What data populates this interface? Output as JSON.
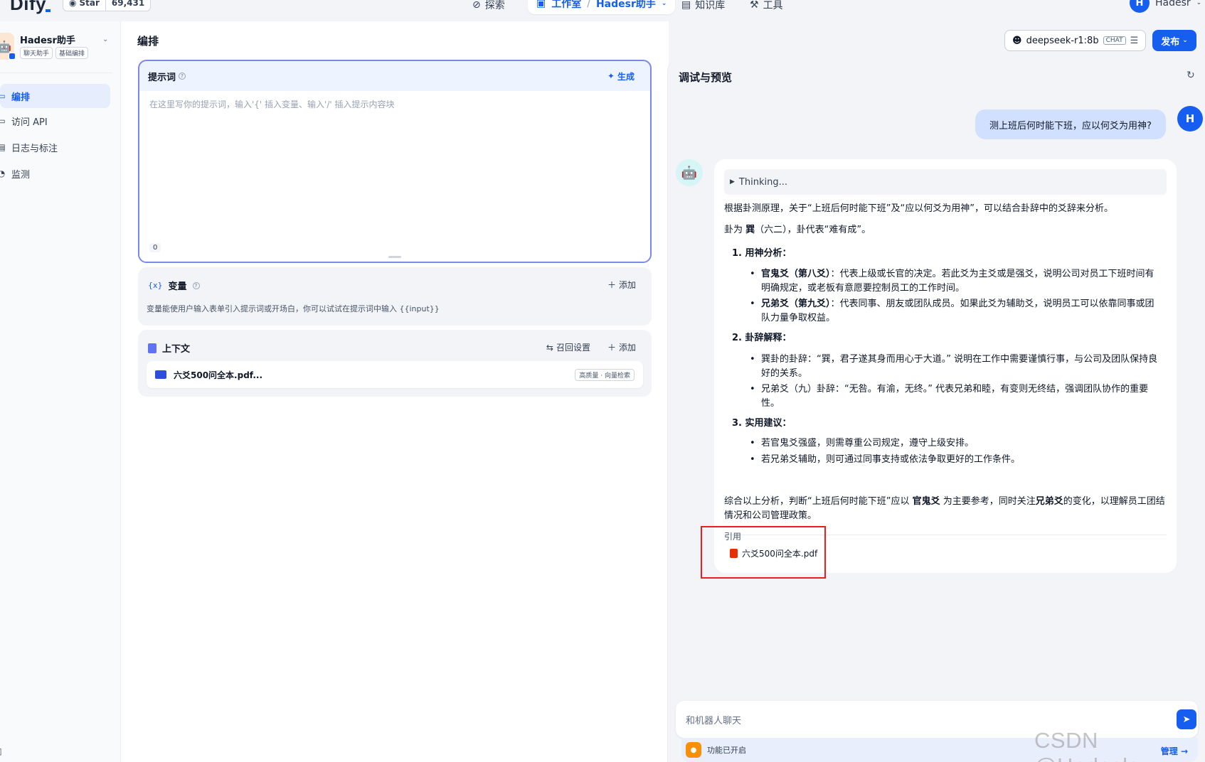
{
  "topbar": {
    "logo": "Dify",
    "star_label": "Star",
    "star_count": "69,431",
    "nav_explore": "探索",
    "nav_studio": "工作室",
    "nav_app": "Hadesr助手",
    "nav_knowledge": "知识库",
    "nav_tools": "工具",
    "user_initial": "H",
    "user_name": "Hadesr"
  },
  "sidebar": {
    "app_name": "Hadesr助手",
    "tags": [
      "聊天助手",
      "基础编排"
    ],
    "items": [
      {
        "label": "编排",
        "active": true
      },
      {
        "label": "访问 API",
        "active": false
      },
      {
        "label": "日志与标注",
        "active": false
      },
      {
        "label": "监测",
        "active": false
      }
    ]
  },
  "header": {
    "title": "编排",
    "model_name": "deepseek-r1:8b",
    "model_tag": "CHAT",
    "publish_label": "发布"
  },
  "prompt": {
    "title": "提示词",
    "generate_label": "生成",
    "placeholder": "在这里写你的提示词，输入'{' 插入变量、输入'/' 插入提示内容块",
    "char_count": "0"
  },
  "variables": {
    "title": "变量",
    "add_label": "添加",
    "description": "变量能使用户输入表单引入提示词或开场白，你可以试试在提示词中输入 {{input}}"
  },
  "context": {
    "title": "上下文",
    "recall_label": "召回设置",
    "add_label": "添加",
    "file_name": "六爻500问全本.pdf...",
    "file_tag": "高质量 · 向量检索"
  },
  "debug": {
    "title": "调试与预览",
    "user_question": "测上班后何时能下班，应以何爻为用神?",
    "user_initial": "H",
    "thinking_label": "Thinking...",
    "answer_intro": "根据卦测原理，关于“上班后何时能下班”及“应以何爻为用神”，可以结合卦辞中的爻辞来分析。",
    "answer_gua_pre": "卦为 ",
    "answer_gua_bold": "巽",
    "answer_gua_post": "（六二），卦代表“难有成”。",
    "section1_title": "1. 用神分析：",
    "s1_b1_bold": "官鬼爻（第八爻）",
    "s1_b1_text": "：代表上级或长官的决定。若此爻为主爻或是强爻，说明公司对员工下班时间有明确规定，或老板有意愿要控制员工的工作时间。",
    "s1_b2_bold": "兄弟爻（第九爻）",
    "s1_b2_text": "：代表同事、朋友或团队成员。如果此爻为辅助爻，说明员工可以依靠同事或团队力量争取权益。",
    "section2_title": "2. 卦辞解释：",
    "s2_b1": "巽卦的卦辞：“巽，君子遂其身而用心于大道。” 说明在工作中需要谨慎行事，与公司及团队保持良好的关系。",
    "s2_b2": "兄弟爻（九）卦辞：“无咎。有渝，无终。” 代表兄弟和睦，有变则无终结，强调团队协作的重要性。",
    "section3_title": "3. 实用建议：",
    "s3_b1": "若官鬼爻强盛，则需尊重公司规定，遵守上级安排。",
    "s3_b2": "若兄弟爻辅助，则可通过同事支持或依法争取更好的工作条件。",
    "conclusion_1": "综合以上分析，判断“上班后何时能下班”应以 ",
    "conclusion_bold1": "官鬼爻",
    "conclusion_2": " 为主要参考，同时关注",
    "conclusion_bold2": "兄弟爻",
    "conclusion_3": "的变化，以理解员工团结情况和公司管理政策。",
    "citation_label": "引用",
    "citation_file": "六爻500问全本.pdf",
    "input_placeholder": "和机器人聊天",
    "features_label": "功能已开启",
    "manage_label": "管理"
  },
  "watermark": "CSDN @Hadesls",
  "colors": {
    "accent": "#155eef",
    "highlight_box": "#ee1d1d"
  }
}
